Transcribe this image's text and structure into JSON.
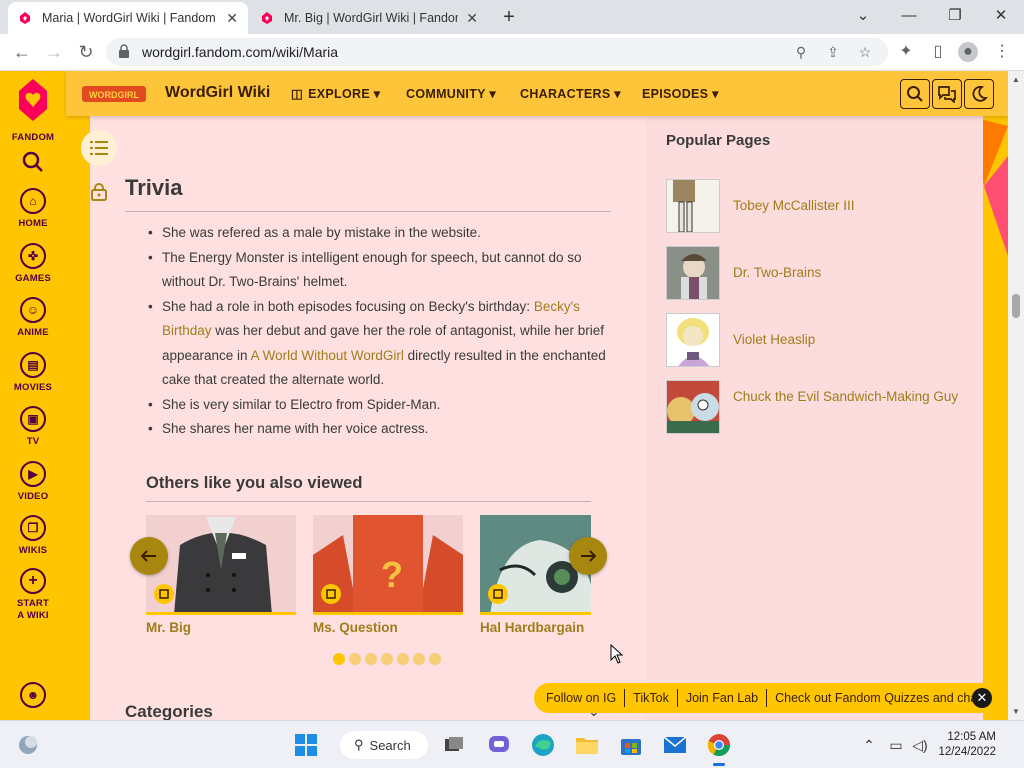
{
  "browser": {
    "tabs": [
      {
        "title": "Maria | WordGirl Wiki | Fandom",
        "active": true
      },
      {
        "title": "Mr. Big | WordGirl Wiki | Fandom",
        "active": false
      }
    ],
    "new_tab_icon": "+",
    "url": "wordgirl.fandom.com/wiki/Maria"
  },
  "fandom_rail": {
    "brand": "FANDOM",
    "items": [
      {
        "label": "HOME",
        "icon": "home-icon"
      },
      {
        "label": "GAMES",
        "icon": "games-icon"
      },
      {
        "label": "ANIME",
        "icon": "anime-icon"
      },
      {
        "label": "MOVIES",
        "icon": "movies-icon"
      },
      {
        "label": "TV",
        "icon": "tv-icon"
      },
      {
        "label": "VIDEO",
        "icon": "video-icon"
      },
      {
        "label": "WIKIS",
        "icon": "wikis-icon"
      },
      {
        "label": "START A WIKI",
        "icon": "plus-icon"
      }
    ]
  },
  "wiki_header": {
    "logo_text": "WORDGIRL",
    "name": "WordGirl Wiki",
    "nav": [
      "EXPLORE",
      "COMMUNITY",
      "CHARACTERS",
      "EPISODES"
    ]
  },
  "trivia": {
    "title": "Trivia",
    "items": [
      {
        "parts": [
          {
            "text": "She was refered as a male by mistake in the website."
          }
        ]
      },
      {
        "parts": [
          {
            "text": "The Energy Monster is intelligent enough for speech, but cannot do so without Dr. Two-Brains' helmet."
          }
        ]
      },
      {
        "parts": [
          {
            "text": "She had a role in both episodes focusing on Becky's birthday: "
          },
          {
            "text": "Becky's Birthday",
            "link": true
          },
          {
            "text": " was her debut and gave her the role of antagonist, while her brief appearance in "
          },
          {
            "text": "A World Without WordGirl",
            "link": true
          },
          {
            "text": " directly resulted in the enchanted cake that created the alternate world."
          }
        ]
      },
      {
        "parts": [
          {
            "text": "She is very similar to Electro from Spider-Man."
          }
        ]
      },
      {
        "parts": [
          {
            "text": "She shares her name with her voice actress."
          }
        ]
      }
    ]
  },
  "others": {
    "title": "Others like you also viewed",
    "cards": [
      "Mr. Big",
      "Ms. Question",
      "Hal Hardbargain"
    ],
    "page_count": 7,
    "active_page": 1
  },
  "categories_title": "Categories",
  "popular": {
    "title": "Popular Pages",
    "items": [
      "Tobey McCallister III",
      "Dr. Two-Brains",
      "Violet Heaslip",
      "Chuck the Evil Sandwich-Making Guy"
    ]
  },
  "promo": {
    "items": [
      "Follow on IG",
      "TikTok",
      "Join Fan Lab",
      "Check out Fandom Quizzes and cha"
    ]
  },
  "taskbar": {
    "search_label": "Search",
    "time": "12:05 AM",
    "date": "12/24/2022"
  },
  "colors": {
    "fandom_yellow": "#ffc500",
    "link": "#a07d1c",
    "content_bg": "#ffe0e0",
    "brand_purple": "#520044"
  }
}
